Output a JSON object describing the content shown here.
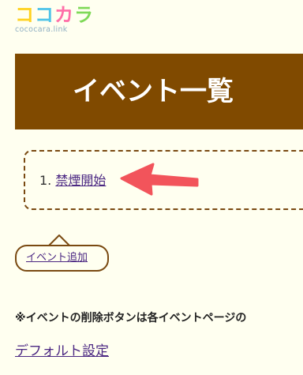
{
  "logo": {
    "mark_chars": [
      "コ",
      "コ",
      "カ",
      "ラ"
    ],
    "subtitle": "cococara.link",
    "colors": [
      "#FFD21F",
      "#4FC3E8",
      "#FF6FA8",
      "#7ED957"
    ]
  },
  "header": {
    "title": "イベント一覧",
    "background": "#804A00"
  },
  "events": {
    "items": [
      {
        "number": "1.",
        "label": "禁煙開始"
      }
    ]
  },
  "add_event": {
    "label": "イベント追加"
  },
  "note": {
    "text": "※イベントの削除ボタンは各イベントページの"
  },
  "settings": {
    "default_label": "デフォルト設定"
  },
  "annotation": {
    "arrow_color": "#F2545B",
    "icon": "red-arrow-icon"
  }
}
